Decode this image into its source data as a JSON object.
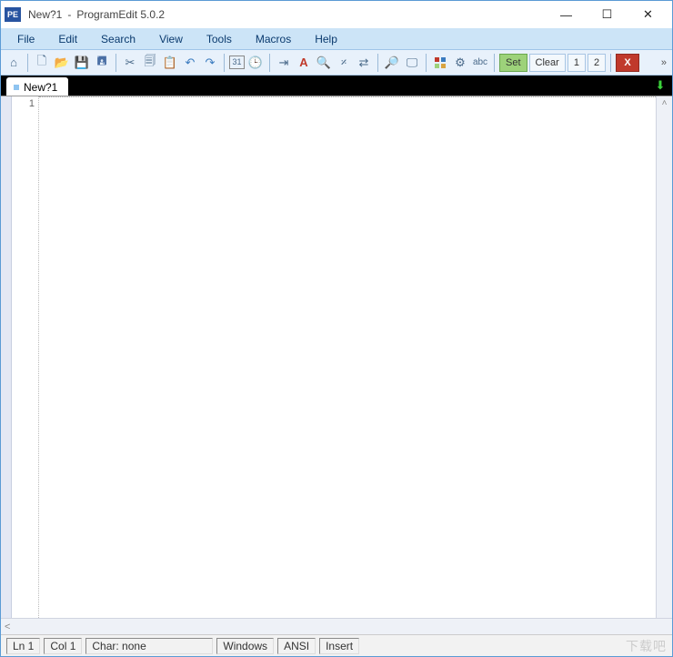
{
  "title": {
    "doc": "New?1",
    "sep": "-",
    "app": "ProgramEdit 5.0.2",
    "appicon_text": "PE"
  },
  "menus": [
    "File",
    "Edit",
    "Search",
    "View",
    "Tools",
    "Macros",
    "Help"
  ],
  "toolbar_buttons": {
    "set": "Set",
    "clear": "Clear",
    "one": "1",
    "two": "2",
    "x": "X",
    "overflow": "»"
  },
  "tabs": [
    {
      "label": "New?1"
    }
  ],
  "gutter": {
    "line1": "1"
  },
  "status": {
    "ln": "Ln 1",
    "col": "Col 1",
    "char": "Char: none",
    "platform": "Windows",
    "encoding": "ANSI",
    "mode": "Insert"
  },
  "watermark": "下载吧"
}
